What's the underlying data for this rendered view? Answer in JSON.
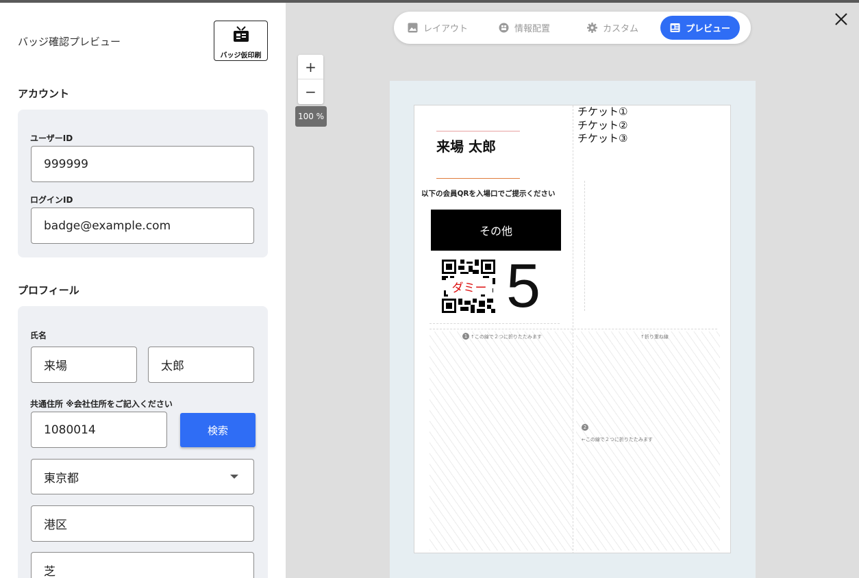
{
  "left_panel": {
    "title": "バッジ確認プレビュー",
    "print_button_label": "バッジ仮印刷",
    "account": {
      "section_title": "アカウント",
      "user_id_label": "ユーザーID",
      "user_id_value": "999999",
      "login_id_label": "ログインID",
      "login_id_value": "badge@example.com"
    },
    "profile": {
      "section_title": "プロフィール",
      "name_label": "氏名",
      "last_name": "来場",
      "first_name": "太郎",
      "address_label": "共通住所 ※会社住所をご記入ください",
      "postal_code": "1080014",
      "search_button": "検索",
      "prefecture": "東京都",
      "city": "港区",
      "town": "芝"
    }
  },
  "tabs": [
    {
      "label": "レイアウト",
      "icon": "image-icon",
      "active": false
    },
    {
      "label": "情報配置",
      "icon": "layout-icon",
      "active": false
    },
    {
      "label": "カスタム",
      "icon": "gear-icon",
      "active": false
    },
    {
      "label": "プレビュー",
      "icon": "badge-icon",
      "active": true
    }
  ],
  "zoom": {
    "plus": "+",
    "minus": "−",
    "level": "100 %"
  },
  "badge": {
    "name": "来場 太郎",
    "notice": "以下の会員QRを入場口でご提示ください",
    "category": "その他",
    "qr_dummy_label": "ダミー",
    "number": "5",
    "tickets": [
      "チケット①",
      "チケット②",
      "チケット③"
    ],
    "fold_instruction_1": "↑この線で２つに折りたたみます",
    "fold_line_label": "↑折り重ね線",
    "fold_instruction_2": "←この線で２つに折りたたみます",
    "step_1": "1",
    "step_2": "2",
    "accent_line_colors": [
      "#e8a0a0",
      "#e07a3a"
    ]
  },
  "colors": {
    "primary": "#2f6df5",
    "canvas": "#e6eef2"
  }
}
